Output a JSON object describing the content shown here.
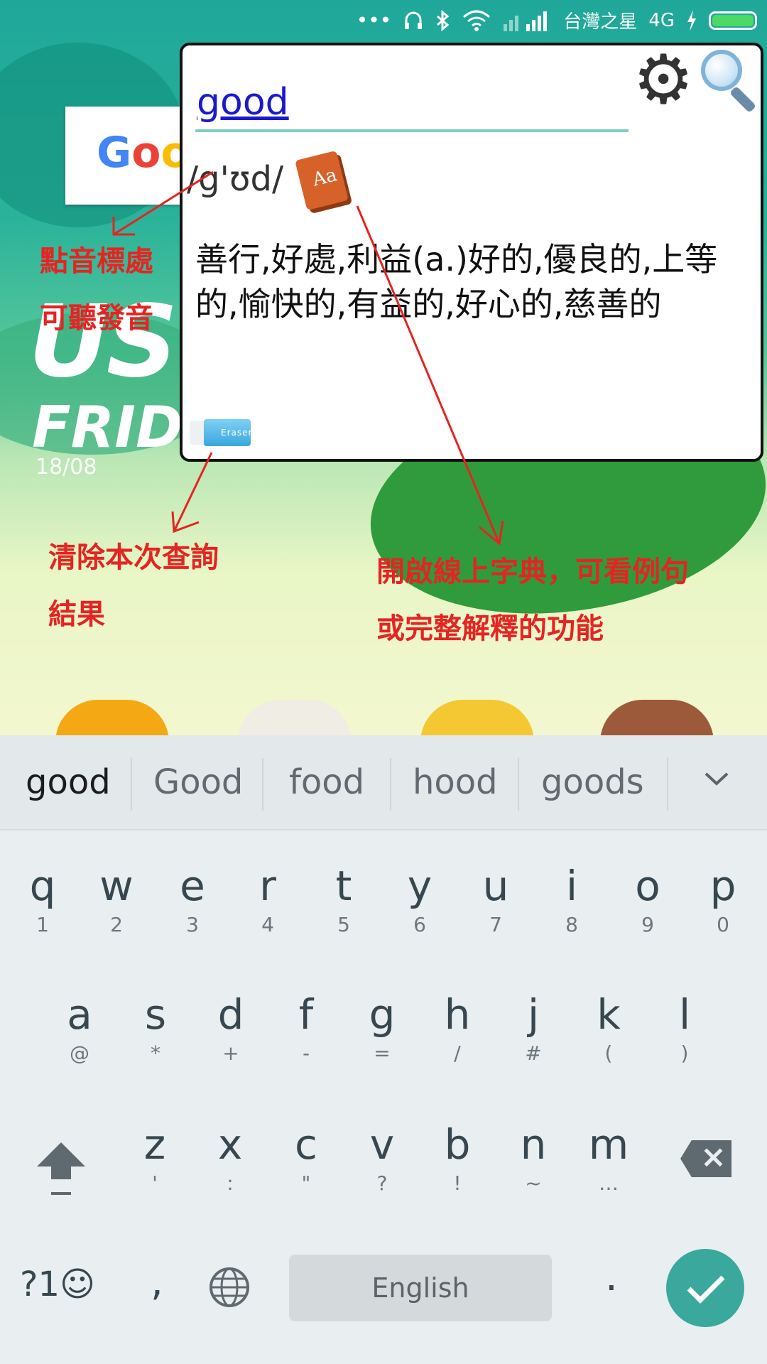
{
  "status_bar": {
    "carrier": "台灣之星",
    "network": "4G"
  },
  "wallpaper": {
    "big_text": "US",
    "day": "FRIDA",
    "date": "18/08",
    "widget_text": "Goo"
  },
  "popup": {
    "word": "good",
    "phonetic": "/g'ʊd/",
    "definition": "善行,好處,利益(a.)好的,優良的,上等的,愉快的,有益的,好心的,慈善的",
    "eraser_label": "Eraser",
    "book_label": "Aa"
  },
  "annotations": {
    "pronounce_line1": "點音標處",
    "pronounce_line2": "可聽發音",
    "clear_line1": "清除本次查詢",
    "clear_line2": "結果",
    "online_line1": "開啟線上字典，可看例句",
    "online_line2": "或完整解釋的功能"
  },
  "keyboard": {
    "suggestions": [
      "good",
      "Good",
      "food",
      "hood",
      "goods"
    ],
    "row1": [
      {
        "k": "q",
        "h": "1"
      },
      {
        "k": "w",
        "h": "2"
      },
      {
        "k": "e",
        "h": "3"
      },
      {
        "k": "r",
        "h": "4"
      },
      {
        "k": "t",
        "h": "5"
      },
      {
        "k": "y",
        "h": "6"
      },
      {
        "k": "u",
        "h": "7"
      },
      {
        "k": "i",
        "h": "8"
      },
      {
        "k": "o",
        "h": "9"
      },
      {
        "k": "p",
        "h": "0"
      }
    ],
    "row2": [
      {
        "k": "a",
        "h": "@"
      },
      {
        "k": "s",
        "h": "*"
      },
      {
        "k": "d",
        "h": "+"
      },
      {
        "k": "f",
        "h": "-"
      },
      {
        "k": "g",
        "h": "="
      },
      {
        "k": "h",
        "h": "/"
      },
      {
        "k": "j",
        "h": "#"
      },
      {
        "k": "k",
        "h": "("
      },
      {
        "k": "l",
        "h": ")"
      }
    ],
    "row3": [
      {
        "k": "z",
        "h": "'"
      },
      {
        "k": "x",
        "h": ":"
      },
      {
        "k": "c",
        "h": "\""
      },
      {
        "k": "v",
        "h": "?"
      },
      {
        "k": "b",
        "h": "!"
      },
      {
        "k": "n",
        "h": "~"
      },
      {
        "k": "m",
        "h": "…"
      }
    ],
    "symbols_label": "?1☺",
    "comma": ",",
    "space_label": "English",
    "period": "."
  },
  "colors": {
    "accent": "#3aa89c",
    "annotation": "#e52422",
    "link": "#1a1acc"
  }
}
